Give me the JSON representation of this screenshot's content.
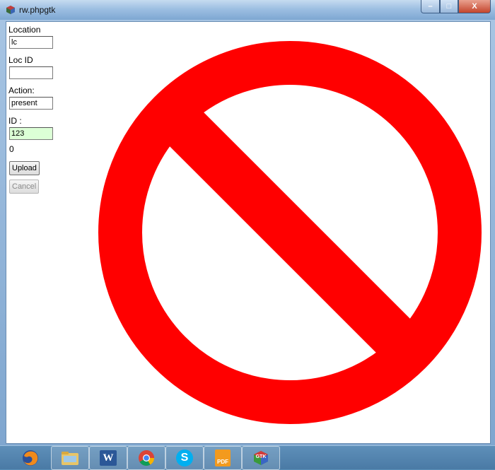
{
  "window": {
    "title": "rw.phpgtk",
    "buttons": {
      "minimize": "–",
      "maximize": "□",
      "close": "X"
    }
  },
  "form": {
    "location": {
      "label": "Location",
      "value": "lc"
    },
    "loc_id": {
      "label": "Loc ID",
      "value": ""
    },
    "action": {
      "label": "Action:",
      "value": "present"
    },
    "id": {
      "label": "ID :",
      "value": "123"
    },
    "count": "0",
    "upload_label": "Upload",
    "cancel_label": "Cancel"
  },
  "graphic": {
    "icon": "prohibited-icon",
    "color": "#ff0000"
  },
  "taskbar": {
    "items": [
      {
        "name": "firefox-icon"
      },
      {
        "name": "file-explorer-icon"
      },
      {
        "name": "word-icon",
        "text": "W"
      },
      {
        "name": "chrome-icon"
      },
      {
        "name": "skype-icon",
        "text": "S"
      },
      {
        "name": "pdf-icon",
        "text": "PDF"
      },
      {
        "name": "gtk-icon",
        "text": "GTK"
      }
    ]
  }
}
